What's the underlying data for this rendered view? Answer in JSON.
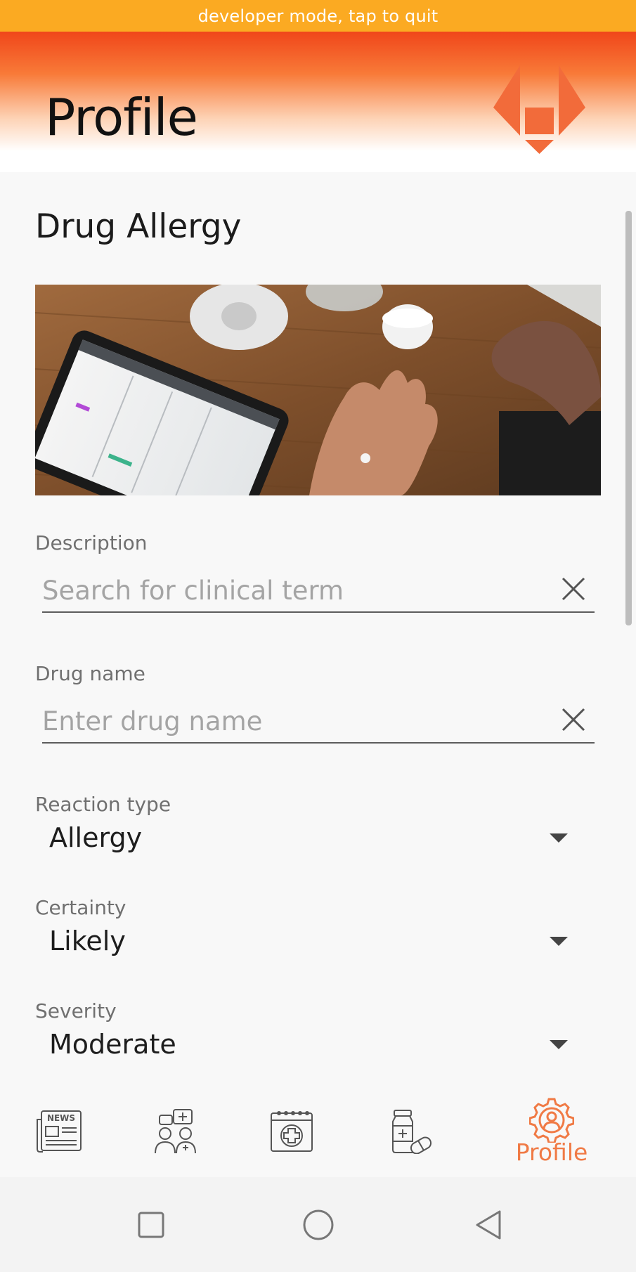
{
  "status_banner": {
    "text": "developer mode, tap to quit"
  },
  "header": {
    "title": "Profile"
  },
  "form": {
    "section_title": "Drug Allergy",
    "description": {
      "label": "Description",
      "placeholder": "Search for clinical term",
      "value": ""
    },
    "drug_name": {
      "label": "Drug name",
      "placeholder": "Enter drug name",
      "value": ""
    },
    "reaction_type": {
      "label": "Reaction type",
      "value": "Allergy"
    },
    "certainty": {
      "label": "Certainty",
      "value": "Likely"
    },
    "severity": {
      "label": "Severity",
      "value": "Moderate"
    }
  },
  "bottom_nav": {
    "items": [
      {
        "icon": "news-icon",
        "label": ""
      },
      {
        "icon": "doctors-chat-icon",
        "label": ""
      },
      {
        "icon": "calendar-medical-icon",
        "label": ""
      },
      {
        "icon": "medication-icon",
        "label": ""
      },
      {
        "icon": "profile-gear-icon",
        "label": "Profile",
        "active": true
      }
    ]
  },
  "colors": {
    "accent": "#f07a45",
    "banner": "#fbaa22",
    "header_top": "#f0461a"
  }
}
